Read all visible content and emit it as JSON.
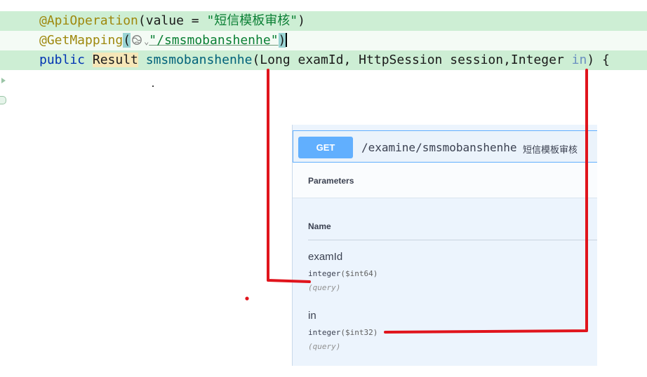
{
  "code": {
    "line1": {
      "annotation": "@ApiOperation",
      "open": "(value = ",
      "value": "\"短信模板审核\"",
      "close": ")"
    },
    "line2": {
      "annotation": "@GetMapping",
      "open_paren": "(",
      "value": "\"/smsmobanshenhe\"",
      "close_paren": ")",
      "icon": "globe-icon"
    },
    "line3": {
      "keyword": "public",
      "return_type": "Result",
      "method_name": "smsmobanshenhe",
      "params_start": "(Long examId, HttpSession session,Integer ",
      "last_param": "in",
      "params_end": ") {"
    }
  },
  "swagger": {
    "method": "GET",
    "path": "/examine/smsmobanshenhe",
    "summary": "短信模板审核",
    "section_title": "Parameters",
    "column_name": "Name",
    "parameters": [
      {
        "name": "examId",
        "type": "integer",
        "format": "($int64)",
        "in": "(query)"
      },
      {
        "name": "in",
        "type": "integer",
        "format": "($int32)",
        "in": "(query)"
      }
    ]
  },
  "colors": {
    "line_highlight": "#cdeed4",
    "get_method": "#61affe",
    "annotation_red": "#e0141c"
  }
}
